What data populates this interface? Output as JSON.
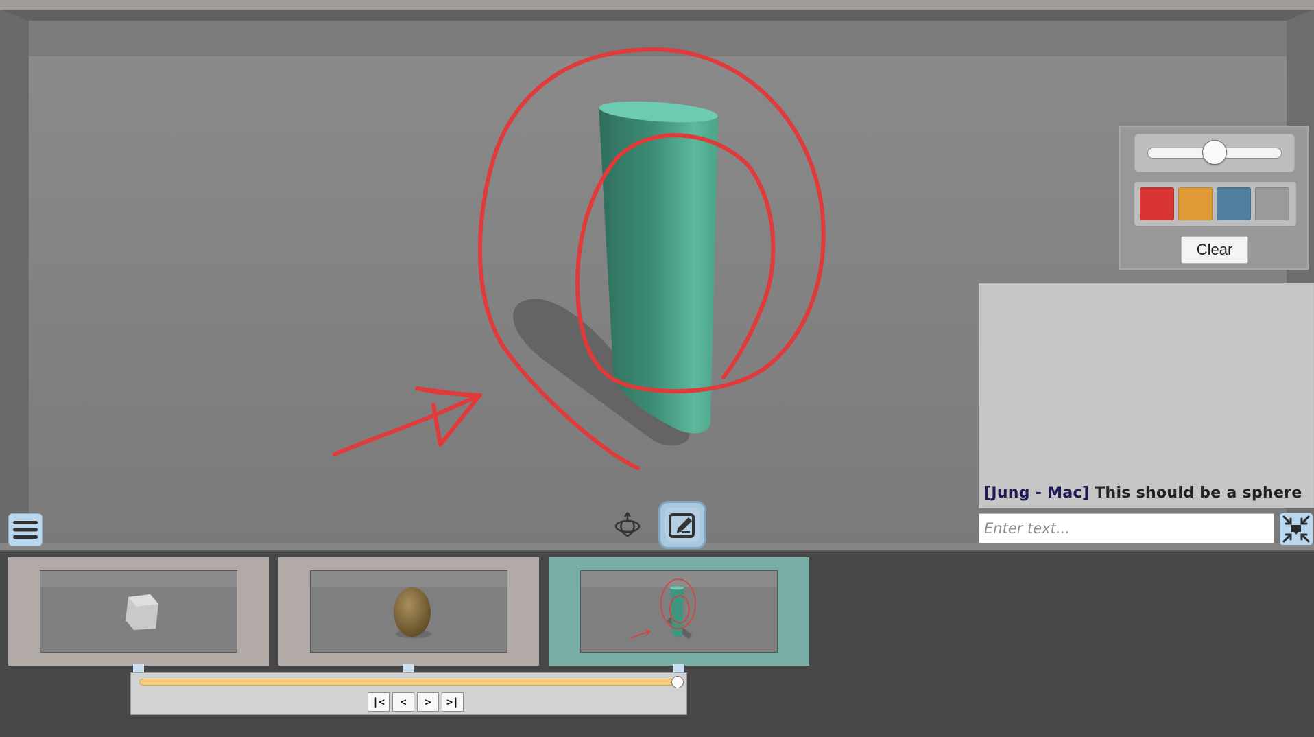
{
  "draw_panel": {
    "brush_size_fraction": 0.5,
    "swatches": [
      {
        "name": "red-swatch",
        "color": "#d93434"
      },
      {
        "name": "orange-swatch",
        "color": "#e09a35"
      },
      {
        "name": "blue-swatch",
        "color": "#4f7e9f"
      },
      {
        "name": "gray-swatch",
        "color": "#9a9a9a"
      }
    ],
    "clear_label": "Clear"
  },
  "chat": {
    "author": "[Jung - Mac]",
    "message": "This should be a sphere",
    "input_placeholder": "Enter text..."
  },
  "toolbar": {
    "menu_icon": "hamburger-menu-icon",
    "orbit_icon": "orbit-rotate-icon",
    "draw_icon": "draw-annotate-icon",
    "collapse_icon": "collapse-chat-icon"
  },
  "timeline": {
    "snapshots": [
      {
        "name": "snapshot-cube",
        "object": "cube",
        "selected": false,
        "color": "#b2aaa6"
      },
      {
        "name": "snapshot-egg",
        "object": "egg",
        "selected": false,
        "color": "#b2aaa6"
      },
      {
        "name": "snapshot-cylinder",
        "object": "cylinder",
        "selected": true,
        "color": "#7aafa8"
      }
    ],
    "position_fraction": 1.0,
    "nav": {
      "first": "|<",
      "prev": "<",
      "next": ">",
      "last": ">|"
    }
  },
  "colors": {
    "annotation": "#e03a3a",
    "cylinder": "#4fae94",
    "accent": "#b9d7ee"
  }
}
